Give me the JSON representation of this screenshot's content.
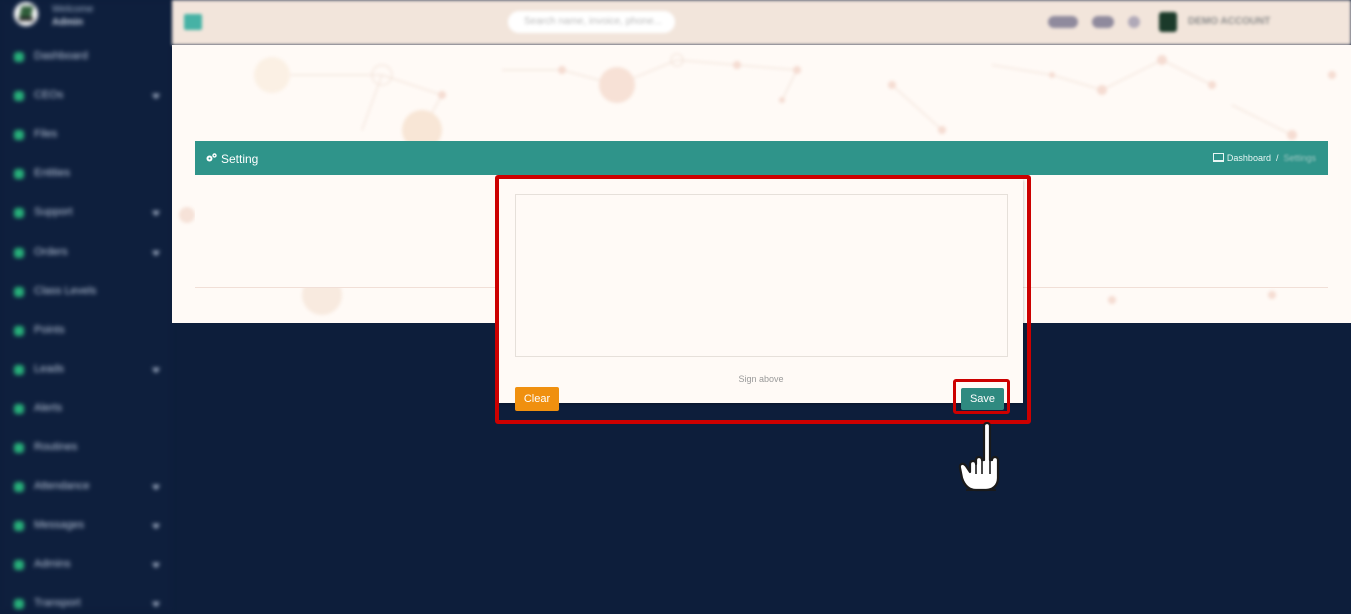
{
  "sidebar": {
    "welcome": "Welcome",
    "user": "Admin",
    "items": [
      {
        "label": "Dashboard",
        "caret": false
      },
      {
        "label": "CEOs",
        "caret": true
      },
      {
        "label": "Files",
        "caret": false
      },
      {
        "label": "Entities",
        "caret": false
      },
      {
        "label": "Support",
        "caret": true
      },
      {
        "label": "Orders",
        "caret": true
      },
      {
        "label": "Class Levels",
        "caret": false
      },
      {
        "label": "Points",
        "caret": false
      },
      {
        "label": "Leads",
        "caret": true
      },
      {
        "label": "Alerts",
        "caret": false
      },
      {
        "label": "Routines",
        "caret": false
      },
      {
        "label": "Attendance",
        "caret": true
      },
      {
        "label": "Messages",
        "caret": true
      },
      {
        "label": "Admins",
        "caret": true
      },
      {
        "label": "Transport",
        "caret": true
      }
    ]
  },
  "topbar": {
    "search_placeholder": "Search name, invoice, phone...",
    "account_label": "DEMO ACCOUNT"
  },
  "panel": {
    "title": "Setting",
    "breadcrumb": {
      "home": "Dashboard",
      "separator": "/",
      "current": "Settings"
    }
  },
  "signature_modal": {
    "hint": "Sign above",
    "clear_label": "Clear",
    "save_label": "Save"
  },
  "colors": {
    "sidebar": "#0e1f3d",
    "header_teal": "#2f948a",
    "clear_orange": "#f0900f",
    "save_teal": "#2f8a80",
    "highlight_red": "#cc0000"
  }
}
